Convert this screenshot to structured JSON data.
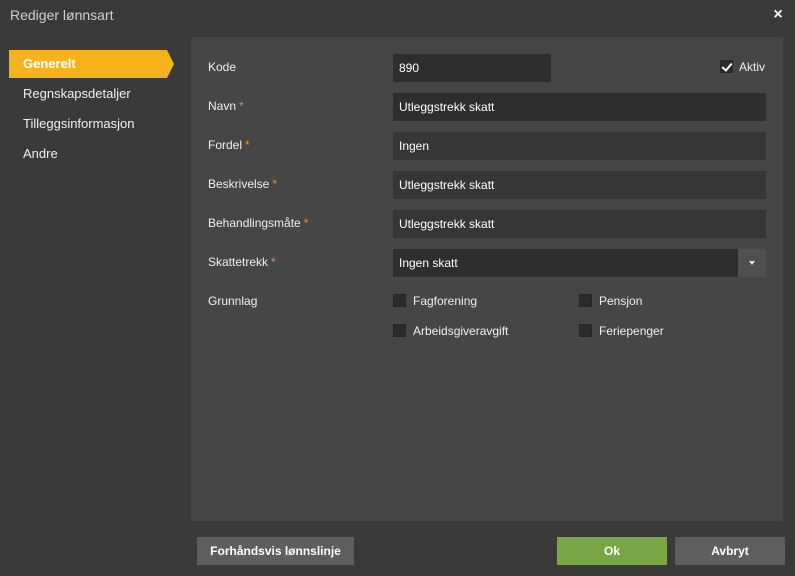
{
  "window": {
    "title": "Rediger lønnsart",
    "close_icon": "×"
  },
  "sidebar": {
    "items": [
      {
        "label": "Generelt",
        "active": true
      },
      {
        "label": "Regnskapsdetaljer"
      },
      {
        "label": "Tilleggsinformasjon"
      },
      {
        "label": "Andre"
      }
    ]
  },
  "form": {
    "kode": {
      "label": "Kode",
      "value": "890"
    },
    "aktiv": {
      "label": "Aktiv",
      "checked": true
    },
    "navn": {
      "label": "Navn",
      "value": "Utleggstrekk skatt"
    },
    "fordel": {
      "label": "Fordel",
      "value": "Ingen"
    },
    "beskrivelse": {
      "label": "Beskrivelse",
      "value": "Utleggstrekk skatt"
    },
    "behandlingsmate": {
      "label": "Behandlingsmåte",
      "value": "Utleggstrekk skatt"
    },
    "skattetrekk": {
      "label": "Skattetrekk",
      "value": "Ingen skatt"
    },
    "required_mark": "*",
    "grunnlag": {
      "label": "Grunnlag",
      "options": [
        {
          "label": "Fagforening",
          "checked": false
        },
        {
          "label": "Pensjon",
          "checked": false
        },
        {
          "label": "Arbeidsgiveravgift",
          "checked": false
        },
        {
          "label": "Feriepenger",
          "checked": false
        }
      ]
    }
  },
  "footer": {
    "preview_label": "Forhåndsvis lønnslinje",
    "ok_label": "Ok",
    "cancel_label": "Avbryt"
  },
  "colors": {
    "accent": "#f5b21d",
    "ok": "#79a544",
    "required": "#f08a2c"
  }
}
